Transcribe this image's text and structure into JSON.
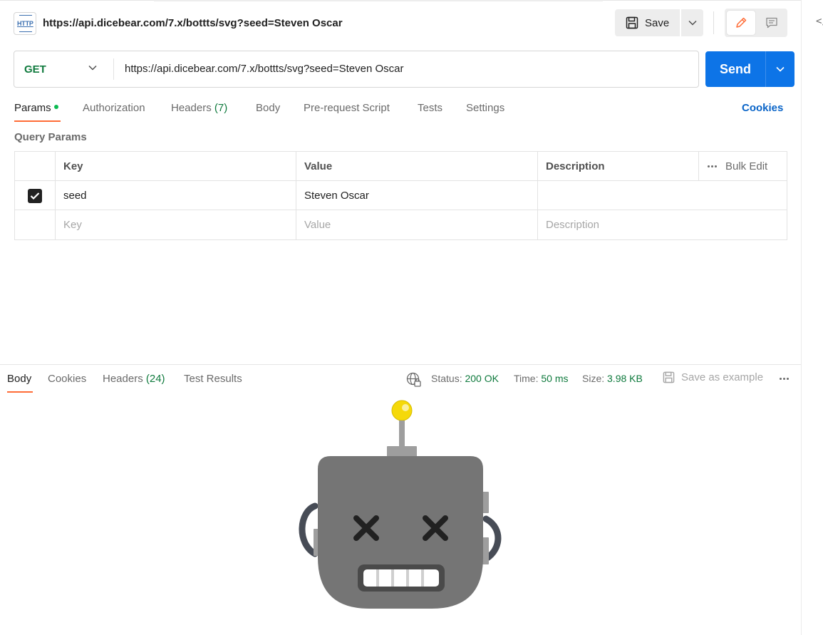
{
  "request": {
    "title": "https://api.dicebear.com/7.x/bottts/svg?seed=Steven Oscar",
    "method": "GET",
    "url": "https://api.dicebear.com/7.x/bottts/svg?seed=Steven Oscar"
  },
  "toolbar": {
    "save_label": "Save",
    "send_label": "Send"
  },
  "request_tabs": {
    "params": "Params",
    "authorization": "Authorization",
    "headers": "Headers",
    "headers_count": "(7)",
    "body": "Body",
    "prerequest": "Pre-request Script",
    "tests": "Tests",
    "settings": "Settings",
    "cookies": "Cookies"
  },
  "query_params": {
    "label": "Query Params",
    "headers": {
      "key": "Key",
      "value": "Value",
      "description": "Description",
      "bulk_edit": "Bulk Edit"
    },
    "rows": [
      {
        "checked": true,
        "key": "seed",
        "value": "Steven Oscar",
        "description": ""
      }
    ],
    "placeholders": {
      "key": "Key",
      "value": "Value",
      "description": "Description"
    }
  },
  "response_tabs": {
    "body": "Body",
    "cookies": "Cookies",
    "headers": "Headers",
    "headers_count": "(24)",
    "test_results": "Test Results"
  },
  "response_meta": {
    "status_label": "Status:",
    "status_value": "200 OK",
    "time_label": "Time:",
    "time_value": "50 ms",
    "size_label": "Size:",
    "size_value": "3.98 KB",
    "save_example": "Save as example"
  },
  "icons": {
    "request_type": "http-icon",
    "save": "floppy-disk-icon",
    "edit": "pencil-icon",
    "comment": "comment-icon",
    "network": "globe-lock-icon",
    "more": "more-horizontal-icon",
    "code": "code-icon"
  },
  "colors": {
    "accent_orange": "#ff6c37",
    "send_blue": "#0d74e7",
    "success_green": "#0f7a3d",
    "link_blue": "#0b65c8"
  }
}
